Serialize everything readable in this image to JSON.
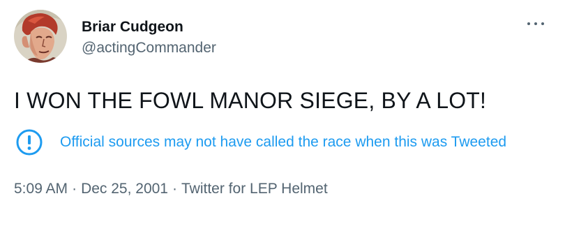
{
  "tweet": {
    "author": {
      "display_name": "Briar Cudgeon",
      "handle": "@actingCommander",
      "avatar_icon": "avatar-illustration"
    },
    "more_icon": "more-options-icon",
    "text": "I WON THE FOWL MANOR SIEGE, BY A LOT!",
    "notice": {
      "icon": "exclamation-circle-icon",
      "text": "Official sources may not have called the race when this was Tweeted"
    },
    "meta": {
      "time": "5:09 AM",
      "separator": "·",
      "date": "Dec 25, 2001",
      "source": "Twitter for LEP Helmet"
    }
  },
  "colors": {
    "primary_text": "#0f1419",
    "secondary_text": "#536471",
    "accent": "#1d9bf0"
  }
}
